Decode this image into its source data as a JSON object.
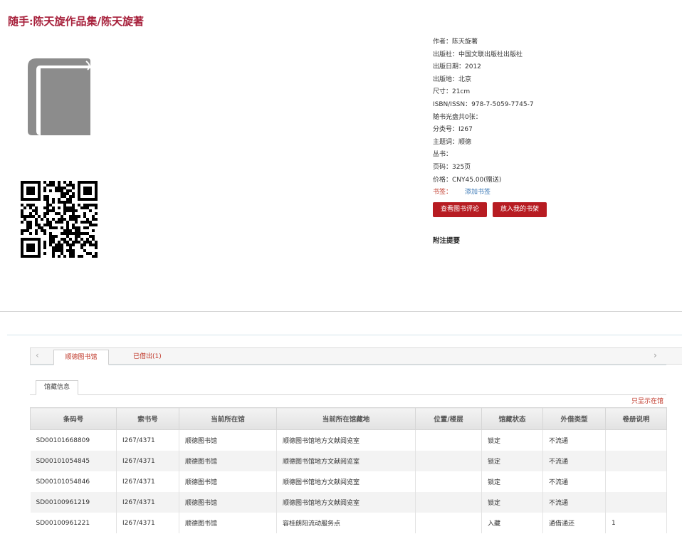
{
  "book": {
    "title": "随手:陈天旋作品集/陈天旋著"
  },
  "meta": {
    "author": "作者：陈天旋著",
    "publisher": "出版社：中国文联出版社出版社",
    "pub_date": "出版日期：2012",
    "pub_place": "出版地：北京",
    "size": "尺寸：21cm",
    "isbn": "ISBN/ISSN：978-7-5059-7745-7",
    "disc": "随书光盘共0张：",
    "class_no": "分类号：I267",
    "subject": "主题词：顺德",
    "series": "丛书：",
    "pages": "页码：325页",
    "price": "价格：CNY45.00(赠送)",
    "bookmark_label": "书签：",
    "add_bookmark": "添加书签"
  },
  "actions": {
    "view_reviews": "查看图书评论",
    "add_shelf": "放入我的书架"
  },
  "notes": {
    "heading": "附注提要"
  },
  "tabs": {
    "prev": "‹",
    "next": "›",
    "library": "顺德图书馆",
    "borrowed": "已借出(1)"
  },
  "holdings": {
    "subtab": "馆藏信息",
    "only_store": "只显示在馆",
    "columns": [
      "条码号",
      "索书号",
      "当前所在馆",
      "当前所在馆藏地",
      "位置/楼层",
      "馆藏状态",
      "外借类型",
      "卷册说明"
    ],
    "rows": [
      [
        "SD00101668809",
        "I267/4371",
        "顺德图书馆",
        "顺德图书馆地方文献阅览室",
        "",
        "锁定",
        "不流通",
        ""
      ],
      [
        "SD00101054845",
        "I267/4371",
        "顺德图书馆",
        "顺德图书馆地方文献阅览室",
        "",
        "锁定",
        "不流通",
        ""
      ],
      [
        "SD00101054846",
        "I267/4371",
        "顺德图书馆",
        "顺德图书馆地方文献阅览室",
        "",
        "锁定",
        "不流通",
        ""
      ],
      [
        "SD00100961219",
        "I267/4371",
        "顺德图书馆",
        "顺德图书馆地方文献阅览室",
        "",
        "锁定",
        "不流通",
        ""
      ],
      [
        "SD00100961221",
        "I267/4371",
        "顺德图书馆",
        "容桂朗阳流动服务点",
        "",
        "入藏",
        "通借通还",
        "1"
      ]
    ]
  },
  "colors": {
    "accent": "#a7203b",
    "button": "#b71c22",
    "link": "#3a78b6"
  },
  "icons": [
    "book-cover-icon",
    "qr-code",
    "chevron-left-icon",
    "chevron-right-icon"
  ]
}
